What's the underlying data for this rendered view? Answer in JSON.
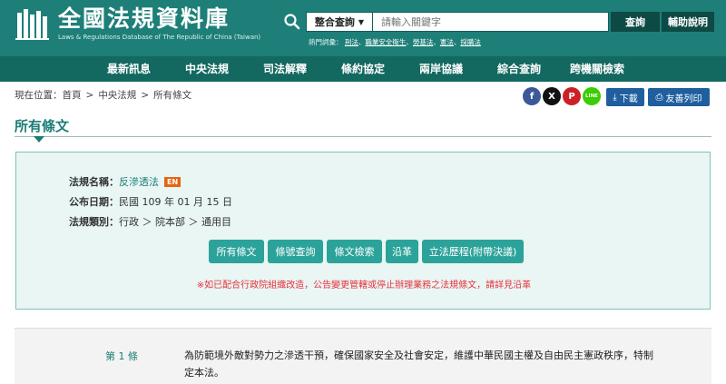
{
  "header": {
    "site_title": "全國法規資料庫",
    "site_subtitle": "Laws & Regulations Database of The Republic of China (Taiwan)",
    "search": {
      "select_value": "整合查詢",
      "placeholder": "請輸入關鍵字",
      "search_label": "查詢",
      "help_label": "輔助說明"
    },
    "hot": {
      "label": "熱門詞彙：",
      "keywords": [
        "刑法",
        "職業安全衛生",
        "勞基法",
        "憲法",
        "採購法"
      ]
    },
    "colors": {
      "header_bg": "#1d7f78",
      "nav_bg": "#136860",
      "button_bg": "#0e4a45"
    }
  },
  "nav": {
    "items": [
      "最新訊息",
      "中央法規",
      "司法解釋",
      "條約協定",
      "兩岸協議",
      "綜合查詢",
      "跨機關檢索"
    ]
  },
  "breadcrumb": {
    "prefix": "現在位置：",
    "items": [
      "首頁",
      ">",
      "中央法規",
      ">",
      "所有條文"
    ]
  },
  "share": {
    "icons": [
      {
        "name": "facebook-icon",
        "glyph": "f",
        "color": "#3b5998"
      },
      {
        "name": "x-icon",
        "glyph": "X",
        "color": "#111111"
      },
      {
        "name": "pinterest-icon",
        "glyph": "P",
        "color": "#cb2027"
      },
      {
        "name": "line-icon",
        "glyph": "LINE",
        "color": "#3acd01"
      }
    ],
    "download_label": "下載",
    "print_label": "友善列印",
    "button_color": "#1f5f9e"
  },
  "section_title": "所有條文",
  "law_info": {
    "name_label": "法規名稱：",
    "name": "反滲透法",
    "en_badge": "EN",
    "date_label": "公布日期：",
    "date": "民國 109 年 01 月 15 日",
    "category_label": "法規類別：",
    "category": "行政 ＞ 院本部 ＞ 通用目",
    "buttons": [
      "所有條文",
      "條號查詢",
      "條文檢索",
      "沿革",
      "立法歷程(附帶決議)"
    ],
    "notice": "※如已配合行政院組織改造，公告變更管轄或停止辦理業務之法規條文，請詳見沿革",
    "colors": {
      "box_bg": "#e9f6f4",
      "button_bg": "#2ca39a",
      "notice": "#e8323c"
    }
  },
  "article": {
    "number": "第 1 條",
    "text": "為防範境外敵對勢力之滲透干預，確保國家安全及社會安定，維護中華民國主權及自由民主憲政秩序，特制定本法。"
  }
}
